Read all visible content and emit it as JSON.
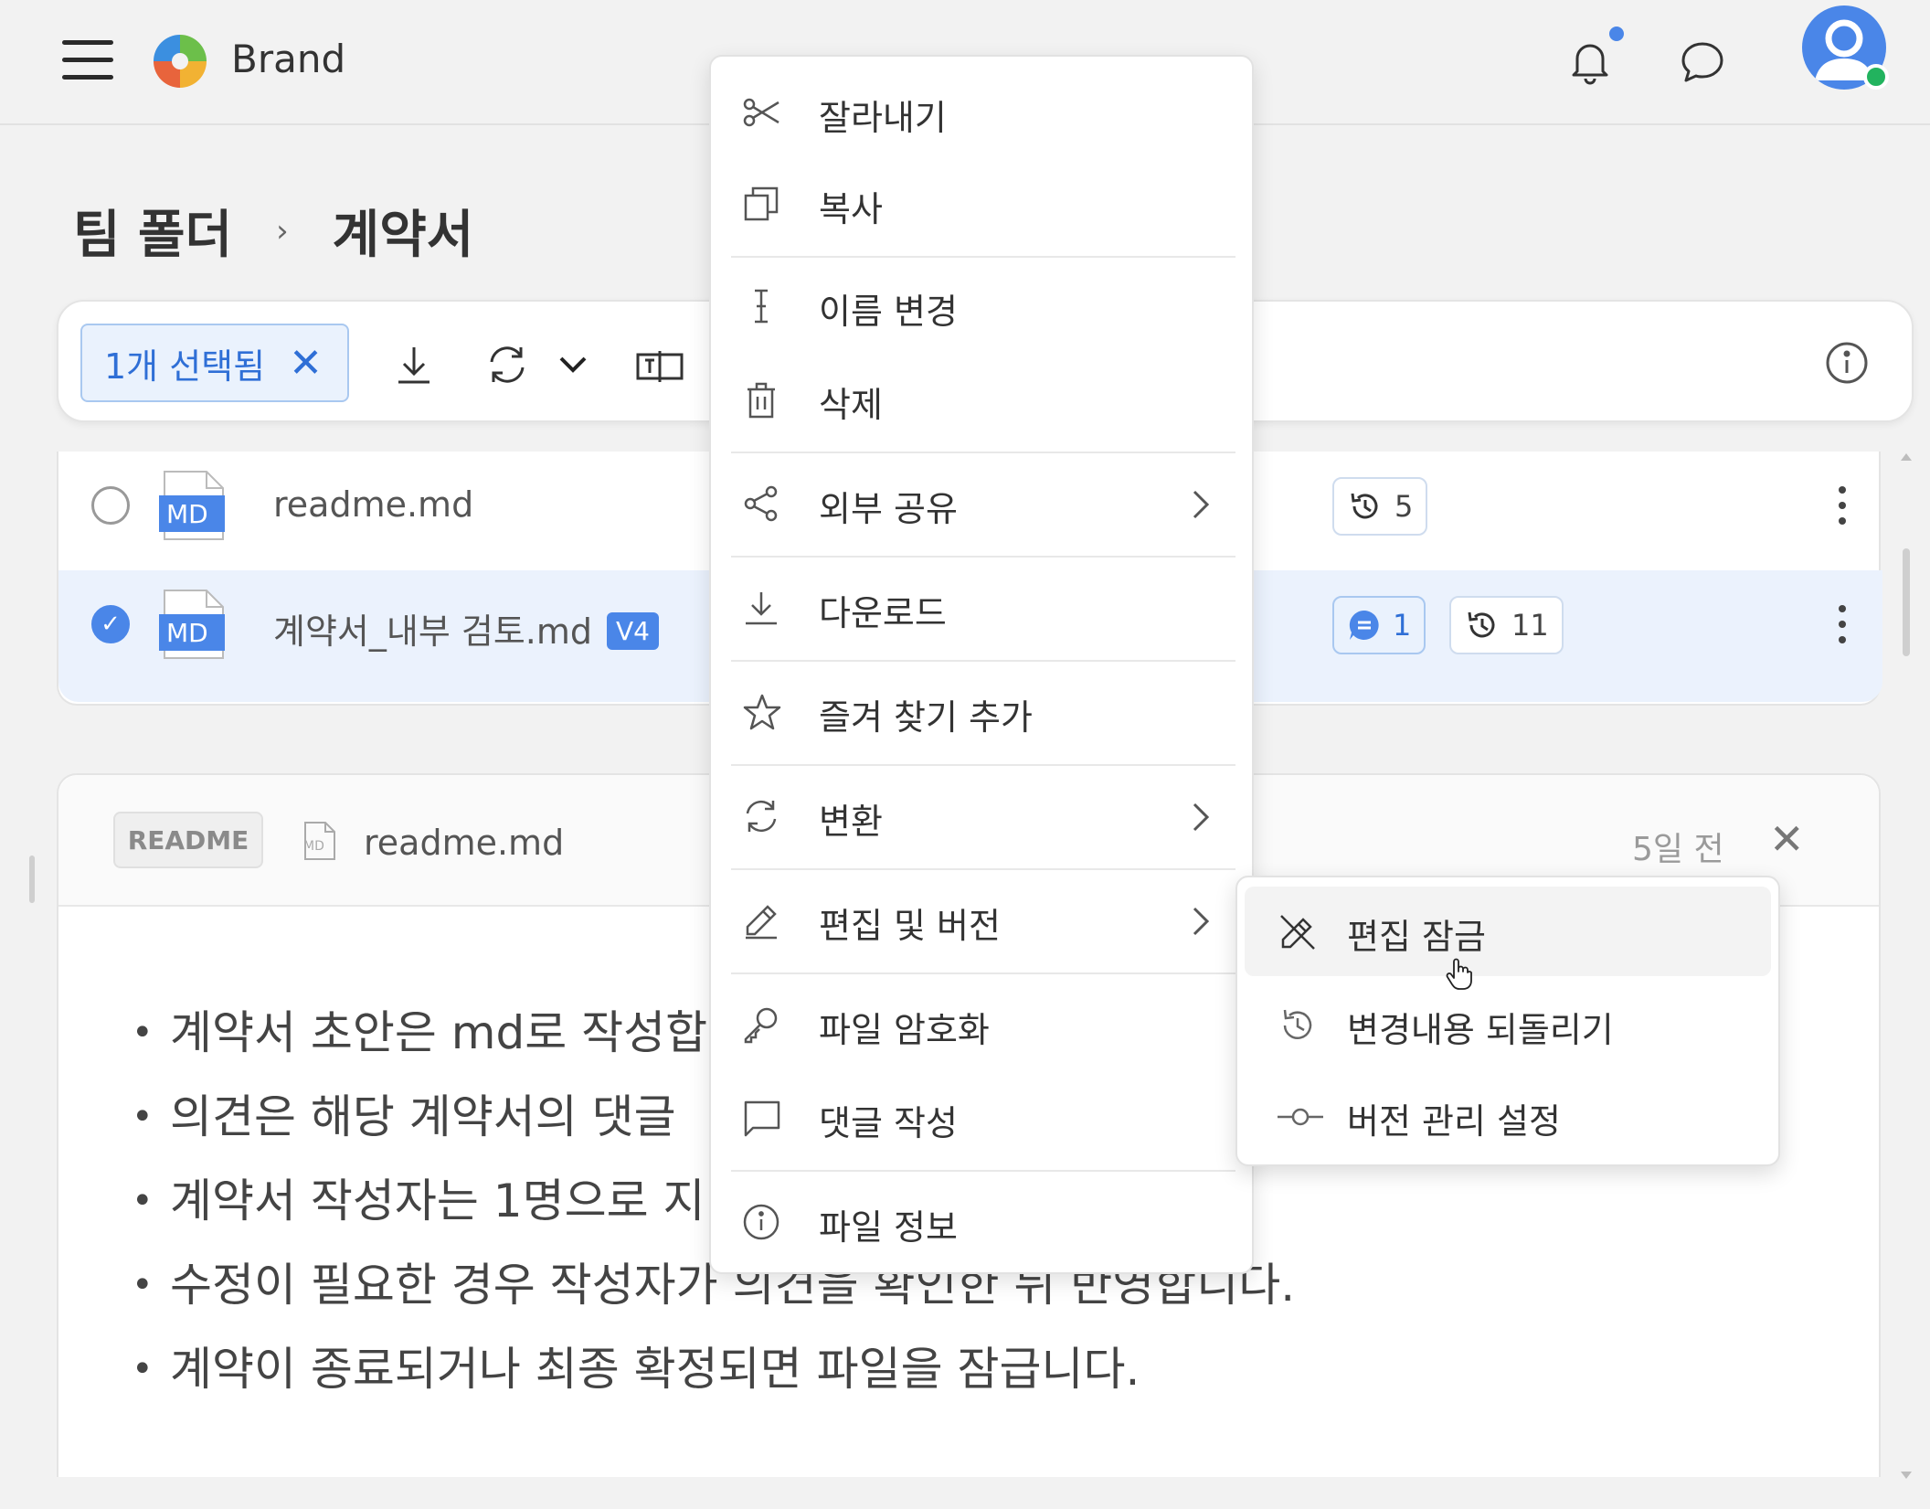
{
  "header": {
    "brand_name": "Brand"
  },
  "breadcrumb": {
    "parent": "팀 폴더",
    "separator": "›",
    "current": "계약서"
  },
  "toolbar": {
    "selection_label": "1개 선택됨",
    "clear_selection": "✕"
  },
  "files": [
    {
      "name": "readme.md",
      "type_label": "MD",
      "selected": false,
      "version_badge": "",
      "comments": "",
      "versions": "5"
    },
    {
      "name": "계약서_내부 검토.md",
      "type_label": "MD",
      "selected": true,
      "version_badge": "V4",
      "comments": "1",
      "versions": "11"
    }
  ],
  "readme": {
    "tag": "README",
    "file_type_label": "MD",
    "file_name": "readme.md",
    "time": "5일 전",
    "close": "✕",
    "lines": [
      "계약서 초안은 md로 작성합",
      "의견은 해당 계약서의 댓글",
      "계약서 작성자는 1명으로 지",
      "수정이 필요한 경우 작성자가 의견을 확인한 뒤 반영합니다.",
      "계약이 종료되거나 최종 확정되면 파일을 잠급니다."
    ]
  },
  "context_menu": {
    "items": [
      {
        "label": "잘라내기",
        "icon": "scissors-icon"
      },
      {
        "label": "복사",
        "icon": "copy-icon"
      },
      {
        "label": "이름 변경",
        "icon": "text-cursor-icon"
      },
      {
        "label": "삭제",
        "icon": "trash-icon"
      },
      {
        "label": "외부 공유",
        "icon": "share-icon",
        "submenu": true
      },
      {
        "label": "다운로드",
        "icon": "download-icon"
      },
      {
        "label": "즐겨 찾기 추가",
        "icon": "star-icon"
      },
      {
        "label": "변환",
        "icon": "convert-icon",
        "submenu": true
      },
      {
        "label": "편집 및 버전",
        "icon": "pencil-icon",
        "submenu": true
      },
      {
        "label": "파일 암호화",
        "icon": "key-icon"
      },
      {
        "label": "댓글 작성",
        "icon": "comment-icon"
      },
      {
        "label": "파일 정보",
        "icon": "info-icon"
      }
    ]
  },
  "submenu": {
    "items": [
      {
        "label": "편집 잠금",
        "icon": "edit-lock-icon",
        "hovered": true
      },
      {
        "label": "변경내용 되돌리기",
        "icon": "history-icon"
      },
      {
        "label": "버전 관리 설정",
        "icon": "commit-icon"
      }
    ]
  },
  "colors": {
    "accent": "#4a86e8",
    "selected_row": "#ebf2fd",
    "online_status": "#22b35e"
  }
}
